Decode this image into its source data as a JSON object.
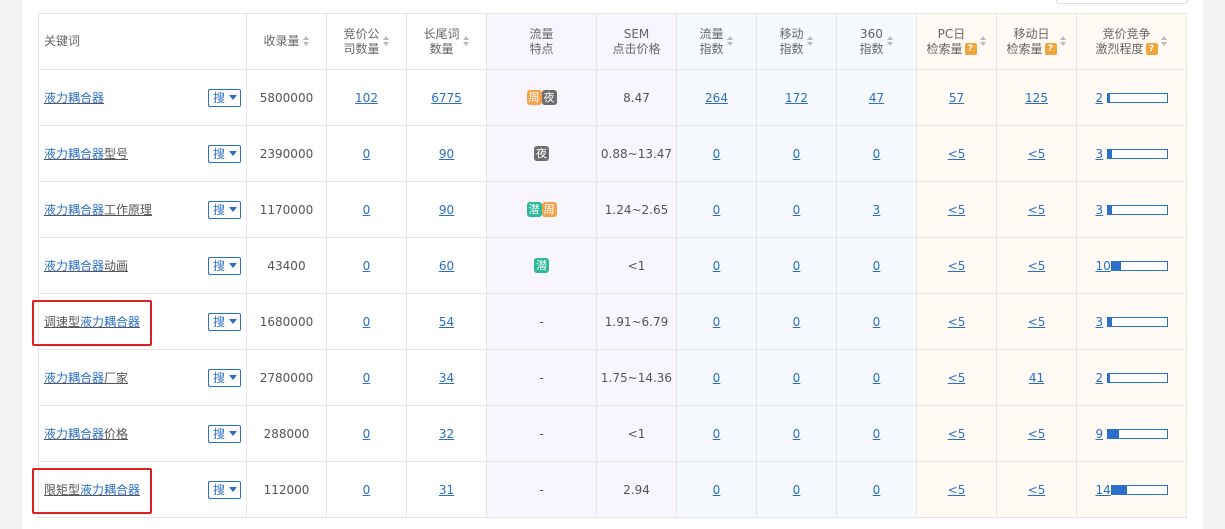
{
  "colors": {
    "link": "#2a6fc9",
    "highlight": "#e02020",
    "tag_zhou": "#f5a24b",
    "tag_ye": "#6e6e6e",
    "tag_qian": "#2cb89a",
    "help": "#f0a53c"
  },
  "headers": {
    "keyword": "关键词",
    "index_count": "收录量",
    "bid_companies": [
      "竞价公",
      "司数量"
    ],
    "longtail": [
      "长尾词",
      "数量"
    ],
    "traffic_feature": [
      "流量",
      "特点"
    ],
    "sem": [
      "SEM",
      "点击价格"
    ],
    "traffic_index": [
      "流量",
      "指数"
    ],
    "mobile_index": [
      "移动",
      "指数"
    ],
    "index_360": [
      "360",
      "指数"
    ],
    "pc_daily": [
      "PC日",
      "检索量"
    ],
    "mobile_daily": [
      "移动日",
      "检索量"
    ],
    "competition": [
      "竞价竞争",
      "激烈程度"
    ],
    "help_mark": "?"
  },
  "search_button": "搜",
  "rows": [
    {
      "kw_prefix": "",
      "kw_link": "液力耦合器",
      "kw_suffix": "",
      "index": "5800000",
      "bid": "102",
      "longtail": "6775",
      "tags": [
        "周",
        "夜"
      ],
      "sem": "8.47",
      "traffic": "264",
      "mobile": "172",
      "i360": "47",
      "pc": "57",
      "mob": "125",
      "comp": "2",
      "comp_level": 0.04
    },
    {
      "kw_prefix": "",
      "kw_link": "液力耦合器",
      "kw_suffix": "型号",
      "index": "2390000",
      "bid": "0",
      "longtail": "90",
      "tags": [
        "夜"
      ],
      "sem": "0.88~13.47",
      "traffic": "0",
      "mobile": "0",
      "i360": "0",
      "pc": "<5",
      "mob": "<5",
      "comp": "3",
      "comp_level": 0.06
    },
    {
      "kw_prefix": "",
      "kw_link": "液力耦合器",
      "kw_suffix": "工作原理",
      "index": "1170000",
      "bid": "0",
      "longtail": "90",
      "tags": [
        "潜",
        "周"
      ],
      "sem": "1.24~2.65",
      "traffic": "0",
      "mobile": "0",
      "i360": "3",
      "pc": "<5",
      "mob": "<5",
      "comp": "3",
      "comp_level": 0.06
    },
    {
      "kw_prefix": "",
      "kw_link": "液力耦合器",
      "kw_suffix": "动画",
      "index": "43400",
      "bid": "0",
      "longtail": "60",
      "tags": [
        "潜"
      ],
      "sem": "<1",
      "traffic": "0",
      "mobile": "0",
      "i360": "0",
      "pc": "<5",
      "mob": "<5",
      "comp": "10",
      "comp_level": 0.15
    },
    {
      "kw_prefix": "调速型",
      "kw_link": "液力耦合器",
      "kw_suffix": "",
      "index": "1680000",
      "bid": "0",
      "longtail": "54",
      "tags": [],
      "tag_empty": "-",
      "sem": "1.91~6.79",
      "traffic": "0",
      "mobile": "0",
      "i360": "0",
      "pc": "<5",
      "mob": "<5",
      "comp": "3",
      "comp_level": 0.06,
      "highlight": true
    },
    {
      "kw_prefix": "",
      "kw_link": "液力耦合器",
      "kw_suffix": "厂家",
      "index": "2780000",
      "bid": "0",
      "longtail": "34",
      "tags": [],
      "tag_empty": "-",
      "sem": "1.75~14.36",
      "traffic": "0",
      "mobile": "0",
      "i360": "0",
      "pc": "<5",
      "mob": "41",
      "comp": "2",
      "comp_level": 0.04
    },
    {
      "kw_prefix": "",
      "kw_link": "液力耦合器",
      "kw_suffix": "价格",
      "index": "288000",
      "bid": "0",
      "longtail": "32",
      "tags": [],
      "tag_empty": "-",
      "sem": "<1",
      "traffic": "0",
      "mobile": "0",
      "i360": "0",
      "pc": "<5",
      "mob": "<5",
      "comp": "9",
      "comp_level": 0.18
    },
    {
      "kw_prefix": "限矩型",
      "kw_link": "液力耦合器",
      "kw_suffix": "",
      "index": "112000",
      "bid": "0",
      "longtail": "31",
      "tags": [],
      "tag_empty": "-",
      "sem": "2.94",
      "traffic": "0",
      "mobile": "0",
      "i360": "0",
      "pc": "<5",
      "mob": "<5",
      "comp": "14",
      "comp_level": 0.25,
      "highlight": true
    }
  ]
}
